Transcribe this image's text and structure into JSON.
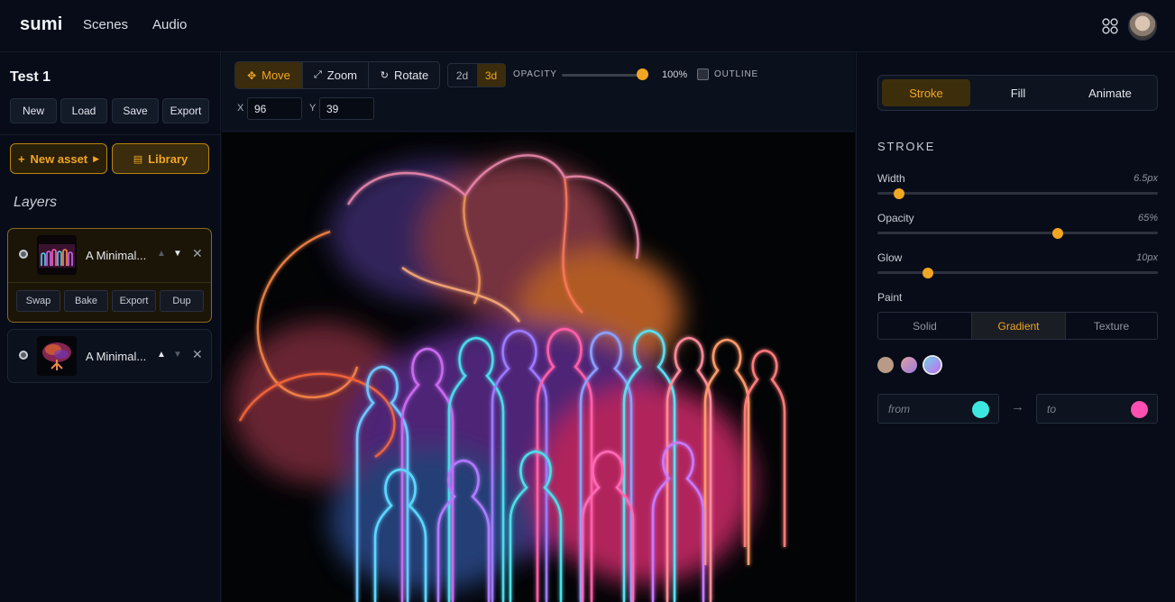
{
  "nav": {
    "brand": "sumi",
    "links": [
      "Scenes",
      "Audio"
    ],
    "apps_icon": "apps-grid-icon",
    "avatar_icon": "user-avatar"
  },
  "sidebar": {
    "project_title": "Test 1",
    "file_buttons": [
      "New",
      "Load",
      "Save",
      "Export"
    ],
    "new_asset_label": "New asset",
    "library_label": "Library",
    "layers_title": "Layers",
    "layers": [
      {
        "name": "A Minimal...",
        "active": true,
        "actions": [
          "Swap",
          "Bake",
          "Export",
          "Dup"
        ]
      },
      {
        "name": "A Minimal...",
        "active": false
      }
    ]
  },
  "toolbar": {
    "tools": [
      "Move",
      "Zoom",
      "Rotate"
    ],
    "active_tool": "Move",
    "dimensions": [
      "2d",
      "3d"
    ],
    "active_dimension": "3d",
    "opacity_label": "OPACITY",
    "opacity_value": "100%",
    "opacity_fraction": 1.0,
    "outline_label": "OUTLINE",
    "outline_checked": false,
    "x_label": "X",
    "x_value": "96",
    "y_label": "Y",
    "y_value": "39"
  },
  "panel": {
    "tabs": [
      "Stroke",
      "Fill",
      "Animate"
    ],
    "active_tab": "Stroke",
    "section_title": "STROKE",
    "sliders": [
      {
        "label": "Width",
        "value": "6.5px",
        "fraction": 0.08
      },
      {
        "label": "Opacity",
        "value": "65%",
        "fraction": 0.65
      },
      {
        "label": "Glow",
        "value": "10px",
        "fraction": 0.18
      }
    ],
    "paint_label": "Paint",
    "paint_tabs": [
      "Solid",
      "Gradient",
      "Texture"
    ],
    "active_paint": "Gradient",
    "swatches": [
      "#b89a86",
      "#c9a0d9",
      "#6fd3e8"
    ],
    "gradient_from_label": "from",
    "gradient_from_color": "#3ee6e0",
    "gradient_to_label": "to",
    "gradient_to_color": "#ff4fb0"
  },
  "colors": {
    "accent": "#f0a623",
    "background": "#060b16"
  }
}
